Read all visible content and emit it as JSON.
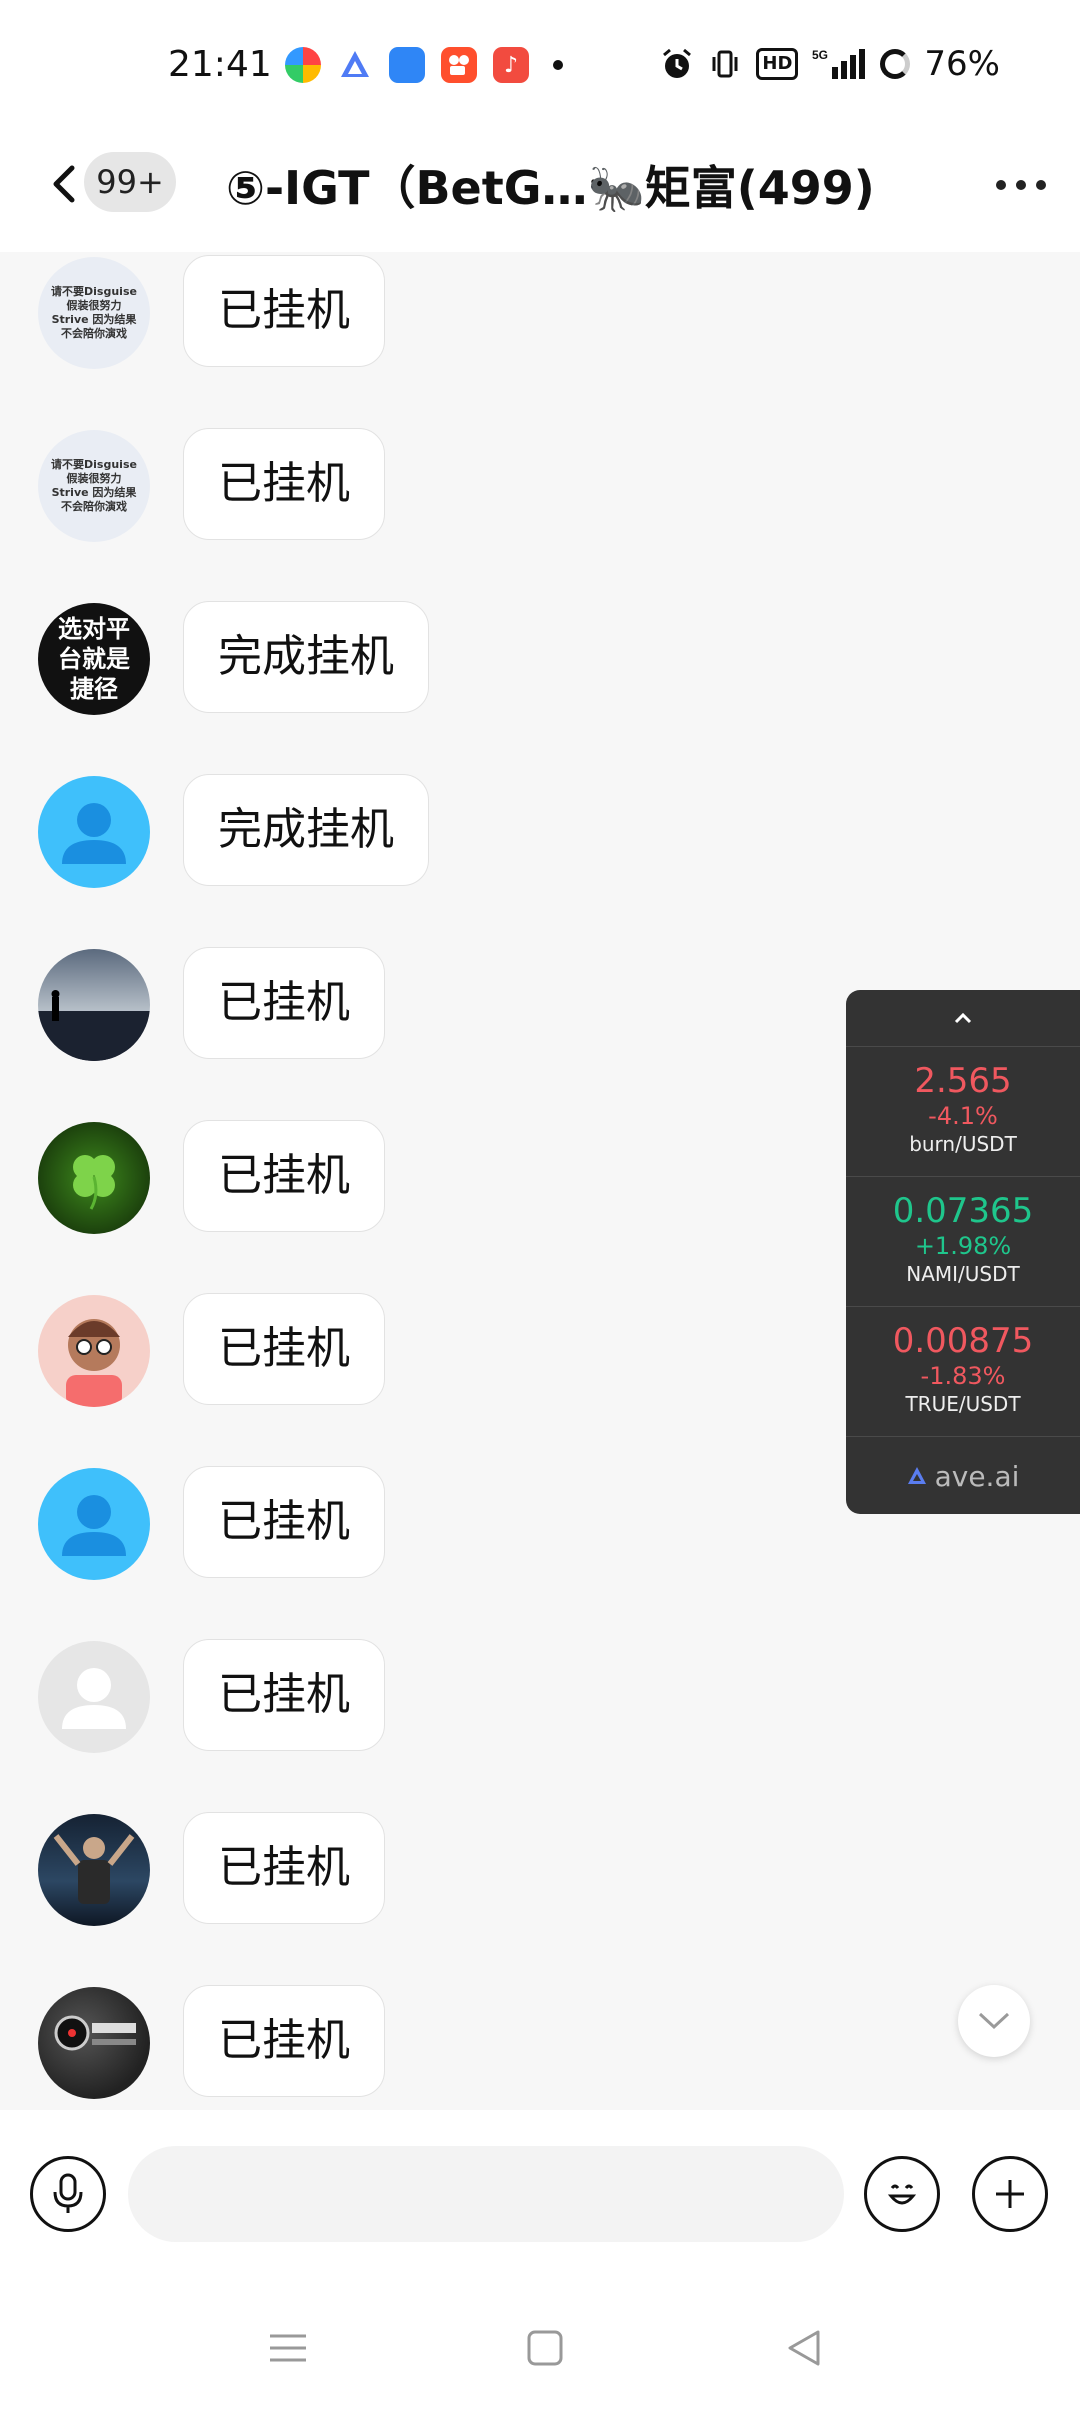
{
  "status_bar": {
    "time": "21:41",
    "network": "5G",
    "hd": "HD",
    "battery": "76%"
  },
  "header": {
    "unread_badge": "99+",
    "title": "⑤-IGT（BetG…🐜矩富(499)"
  },
  "messages": [
    {
      "text": "已挂机",
      "avatar_label": "请不要Disguise 假装很努力 Strive 因为结果 不会陪你演戏"
    },
    {
      "text": "已挂机",
      "avatar_label": "请不要Disguise 假装很努力 Strive 因为结果 不会陪你演戏"
    },
    {
      "text": "完成挂机",
      "avatar_label": "选对平台就是捷径"
    },
    {
      "text": "完成挂机"
    },
    {
      "text": "已挂机"
    },
    {
      "text": "已挂机"
    },
    {
      "text": "已挂机"
    },
    {
      "text": "已挂机"
    },
    {
      "text": "已挂机"
    },
    {
      "text": "已挂机"
    },
    {
      "text": "已挂机"
    }
  ],
  "price_widget": {
    "items": [
      {
        "price": "2.565",
        "change": "-4.1%",
        "pair": "burn/USDT",
        "trend": "down"
      },
      {
        "price": "0.07365",
        "change": "+1.98%",
        "pair": "NAMI/USDT",
        "trend": "up"
      },
      {
        "price": "0.00875",
        "change": "-1.83%",
        "pair": "TRUE/USDT",
        "trend": "down"
      }
    ],
    "brand": "ave.ai",
    "colors": {
      "down": "#f0585f",
      "up": "#1fc68c",
      "background": "#333333"
    }
  },
  "input_bar": {
    "placeholder": "",
    "icons": [
      "microphone-icon",
      "emoji-icon",
      "plus-icon"
    ]
  },
  "nav_bar": {
    "icons": [
      "menu-icon",
      "home-icon",
      "back-icon"
    ]
  }
}
